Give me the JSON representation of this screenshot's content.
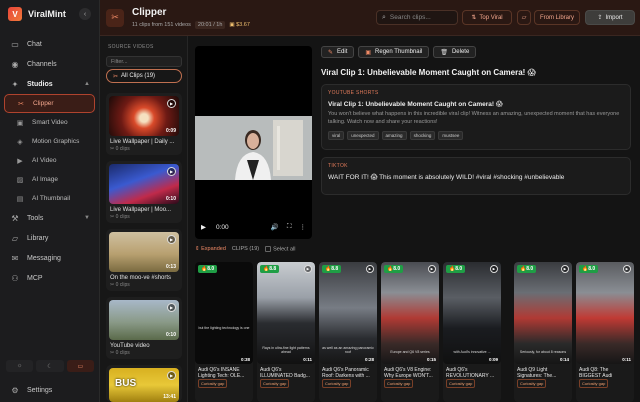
{
  "app": {
    "name": "ViralMint",
    "logo_letter": "V"
  },
  "sidebar": {
    "items_top": [
      {
        "label": "Chat",
        "icon": "chat-icon"
      },
      {
        "label": "Channels",
        "icon": "antenna-icon"
      }
    ],
    "studios_label": "Studios",
    "studios": [
      {
        "label": "Clipper",
        "icon": "scissors-icon",
        "active": true
      },
      {
        "label": "Smart Video",
        "icon": "monitor-icon"
      },
      {
        "label": "Motion Graphics",
        "icon": "layers-icon"
      },
      {
        "label": "AI Video",
        "icon": "video-icon"
      },
      {
        "label": "AI Image",
        "icon": "image-icon"
      },
      {
        "label": "AI Thumbnail",
        "icon": "thumbnail-icon"
      }
    ],
    "items_bottom": [
      {
        "label": "Tools",
        "icon": "wrench-icon"
      },
      {
        "label": "Library",
        "icon": "folder-icon"
      },
      {
        "label": "Messaging",
        "icon": "message-icon"
      },
      {
        "label": "MCP",
        "icon": "network-icon"
      }
    ],
    "settings_label": "Settings"
  },
  "header": {
    "title": "Clipper",
    "meta_clips": "11 clips from 151 videos",
    "meta_time": "20:01 / 1h",
    "meta_credits": "$3.67",
    "search_placeholder": "Search clips...",
    "top_viral": "Top Viral",
    "from_library": "From Library",
    "import": "Import"
  },
  "source": {
    "title": "SOURCE VIDEOS",
    "filter_placeholder": "Filter...",
    "all_clips": "All Clips (19)",
    "videos": [
      {
        "title": "Live Wallpaper | Daily ...",
        "duration": "0:09",
        "clips": "0 clips"
      },
      {
        "title": "Live Wallpaper | Moo...",
        "duration": "0:10",
        "clips": "0 clips"
      },
      {
        "title": "On the moo-ve #shorts",
        "duration": "0:13",
        "clips": "0 clips"
      },
      {
        "title": "YouTube video",
        "duration": "0:10",
        "clips": "0 clips"
      },
      {
        "title": "",
        "duration": "13:41",
        "clips": "",
        "thumb_text": "BUS"
      }
    ]
  },
  "player": {
    "time": "0:00"
  },
  "actions": {
    "edit": "Edit",
    "regen": "Regen Thumbnail",
    "delete": "Delete"
  },
  "clip": {
    "title": "Viral Clip 1: Unbelievable Moment Caught on Camera! 😱",
    "youtube_label": "YOUTUBE SHORTS",
    "youtube_title": "Viral Clip 1: Unbelievable Moment Caught on Camera! 😱",
    "youtube_desc": "You won't believe what happens in this incredible viral clip! Witness an amazing, unexpected moment that has everyone talking. Watch now and share your reactions!",
    "tags": [
      "viral",
      "unexpected",
      "amazing",
      "shocking",
      "mustsee"
    ],
    "tiktok_label": "TIKTOK",
    "tiktok_text": "WAIT FOR IT! 😱 This moment is absolutely WILD! #viral #shocking #unbelievable"
  },
  "strip": {
    "expanded": "Expanded",
    "clips_count": "CLIPS (19)",
    "select_all": "Select all",
    "clips": [
      {
        "score": "8.0",
        "title": "Audi Q6's INSANE Lighting Tech: OLE...",
        "pill": "Curiosity gap",
        "duration": "0:38",
        "caption": "but the lighting technology is one"
      },
      {
        "score": "8.8",
        "title": "Audi Q6's ILLUMINATED Badg...",
        "pill": "Curiosity gap",
        "duration": "0:11",
        "caption": "Rays in ultra-fine light patterns ahead"
      },
      {
        "score": "8.8",
        "title": "Audi Q6's Panoramic Roof: Darkens with ...",
        "pill": "Curiosity gap",
        "duration": "0:28",
        "caption": "as well as an amazing panoramic roof"
      },
      {
        "score": "8.0",
        "title": "Audi Q6's V8 Engine: Why Europe WON'T...",
        "pill": "Curiosity gap",
        "duration": "0:15",
        "caption": "Europe and Q6 V8 series"
      },
      {
        "score": "8.0",
        "title": "Audi Q6's REVOLUTIONARY ...",
        "pill": "Curiosity gap",
        "duration": "0:09",
        "caption": "with Audi's innovative ..."
      },
      {
        "score": "8.0",
        "title": "Audi Q9 Light Signatures: The...",
        "pill": "Curiosity gap",
        "duration": "0:14",
        "caption": "Seriously, for about 8 reasons"
      },
      {
        "score": "8.0",
        "title": "Audi Q8: The BIGGEST Audi EVER...",
        "pill": "Curiosity gap",
        "duration": "0:11",
        "caption": ""
      }
    ]
  },
  "colors": {
    "accent": "#f08a66",
    "score_green": "#1f9e45",
    "header_bg": "#2a1813"
  }
}
